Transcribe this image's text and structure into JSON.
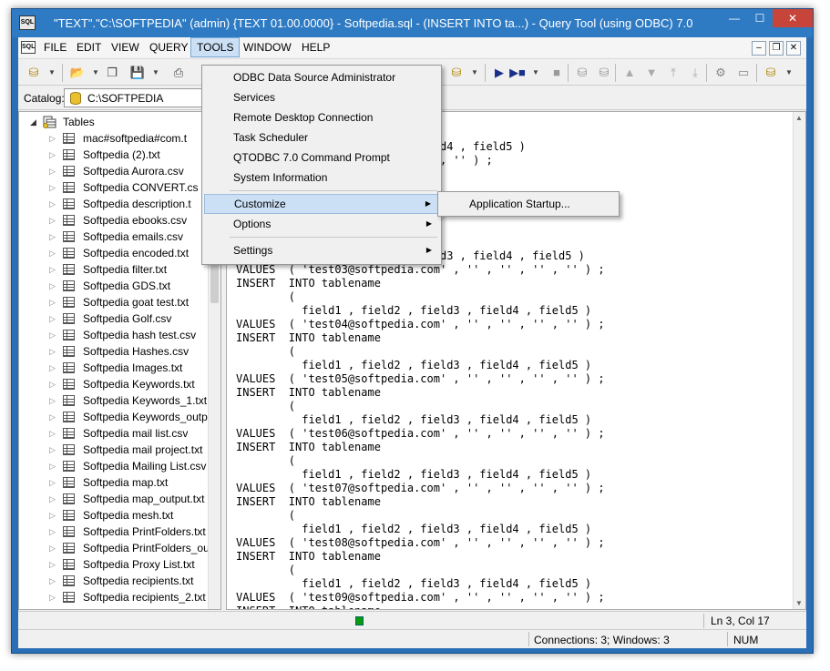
{
  "window": {
    "title": "\"TEXT\".\"C:\\SOFTPEDIA\" (admin) {TEXT 01.00.0000} - Softpedia.sql - (INSERT  INTO ta...) - Query Tool (using ODBC) 7.0",
    "app_icon_text": "SQL",
    "minimize": "—",
    "maximize": "☐",
    "close": "✕"
  },
  "menubar": {
    "items": [
      "FILE",
      "EDIT",
      "VIEW",
      "QUERY",
      "TOOLS",
      "WINDOW",
      "HELP"
    ],
    "active": "TOOLS",
    "mdi_min": "–",
    "mdi_restore": "❐",
    "mdi_close": "✕"
  },
  "catalog": {
    "label": "Catalog:",
    "value": "C:\\SOFTPEDIA"
  },
  "tree": {
    "root_label": "Tables",
    "items": [
      "mac#softpedia#com.t",
      "Softpedia (2).txt",
      "Softpedia Aurora.csv",
      "Softpedia CONVERT.cs",
      "Softpedia description.t",
      "Softpedia ebooks.csv",
      "Softpedia emails.csv",
      "Softpedia encoded.txt",
      "Softpedia filter.txt",
      "Softpedia GDS.txt",
      "Softpedia goat test.txt",
      "Softpedia Golf.csv",
      "Softpedia hash test.csv",
      "Softpedia Hashes.csv",
      "Softpedia Images.txt",
      "Softpedia Keywords.txt",
      "Softpedia Keywords_1.txt",
      "Softpedia Keywords_outpu",
      "Softpedia mail list.csv",
      "Softpedia mail project.txt",
      "Softpedia Mailing List.csv",
      "Softpedia map.txt",
      "Softpedia map_output.txt",
      "Softpedia mesh.txt",
      "Softpedia PrintFolders.txt",
      "Softpedia PrintFolders_out",
      "Softpedia Proxy List.txt",
      "Softpedia recipients.txt",
      "Softpedia recipients_2.txt"
    ]
  },
  "editor": {
    "lines": [
      "                  field3 , field4 , field5 )",
      "                  '' , '' , '' , '' ) ;",
      "",
      "",
      "",
      "",
      "",
      "",
      "         field1 , field2 , field3 , field4 , field5 )",
      "VALUES  ( 'test03@softpedia.com' , '' , '' , '' , '' ) ;",
      "INSERT  INTO tablename",
      "        (",
      "          field1 , field2 , field3 , field4 , field5 )",
      "VALUES  ( 'test04@softpedia.com' , '' , '' , '' , '' ) ;",
      "INSERT  INTO tablename",
      "        (",
      "          field1 , field2 , field3 , field4 , field5 )",
      "VALUES  ( 'test05@softpedia.com' , '' , '' , '' , '' ) ;",
      "INSERT  INTO tablename",
      "        (",
      "          field1 , field2 , field3 , field4 , field5 )",
      "VALUES  ( 'test06@softpedia.com' , '' , '' , '' , '' ) ;",
      "INSERT  INTO tablename",
      "        (",
      "          field1 , field2 , field3 , field4 , field5 )",
      "VALUES  ( 'test07@softpedia.com' , '' , '' , '' , '' ) ;",
      "INSERT  INTO tablename",
      "        (",
      "          field1 , field2 , field3 , field4 , field5 )",
      "VALUES  ( 'test08@softpedia.com' , '' , '' , '' , '' ) ;",
      "INSERT  INTO tablename",
      "        (",
      "          field1 , field2 , field3 , field4 , field5 )",
      "VALUES  ( 'test09@softpedia.com' , '' , '' , '' , '' ) ;",
      "INSERT  INTO tablename"
    ]
  },
  "tools_menu": {
    "items": [
      "ODBC Data Source Administrator",
      "Services",
      "Remote Desktop Connection",
      "Task Scheduler",
      "QTODBC 7.0 Command Prompt",
      "System Information"
    ],
    "customize": "Customize",
    "options": "Options",
    "settings": "Settings",
    "highlighted": "Customize"
  },
  "customize_submenu": {
    "items": [
      "Application Startup..."
    ]
  },
  "status": {
    "position": "Ln 3, Col 17",
    "connections": "Connections: 3; Windows: 3",
    "num": "NUM",
    "indicator_color": "#0a9a0a"
  },
  "icons": [
    "app-sql-icon",
    "database-icon",
    "open-folder-icon",
    "save-icon",
    "print-icon",
    "run-icon",
    "stop-icon",
    "table-icon",
    "chevron-right-icon"
  ]
}
